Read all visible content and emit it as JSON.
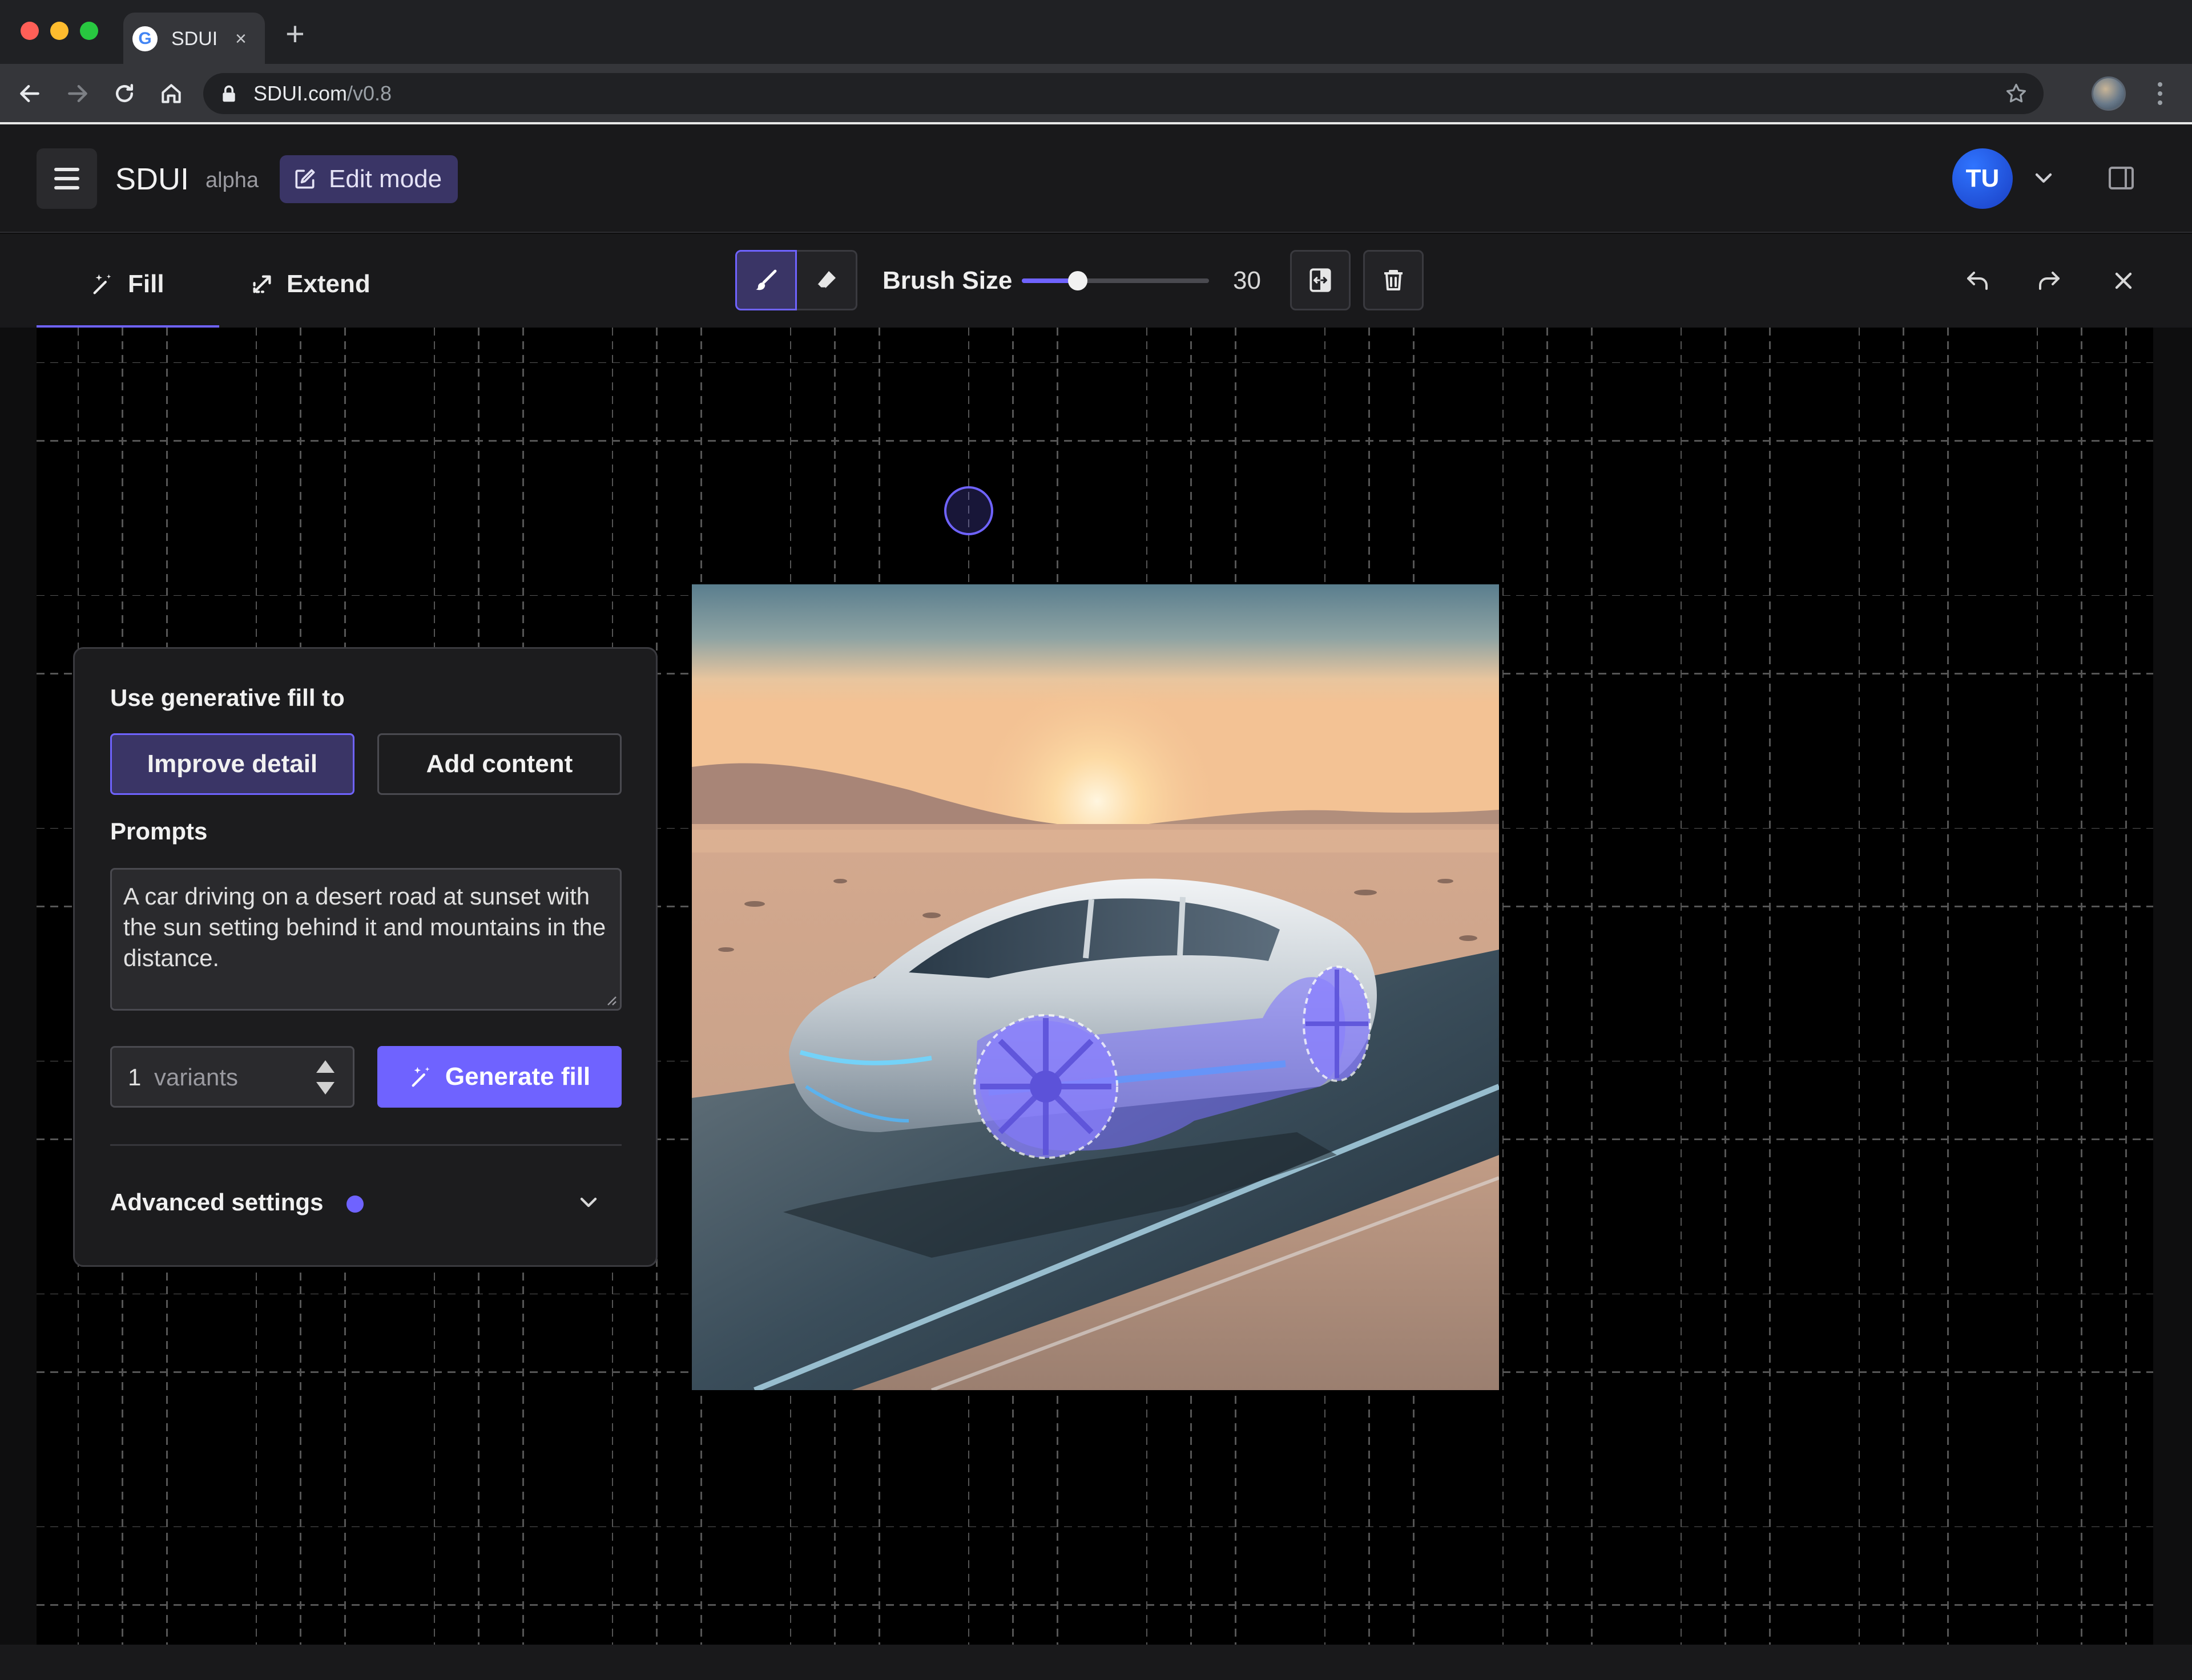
{
  "browser": {
    "tab_title": "SDUI",
    "tab_close": "×",
    "new_tab": "+",
    "favicon_letter": "G",
    "url_host": "SDUI.com",
    "url_path": "/v0.8"
  },
  "header": {
    "brand": "SDUI",
    "brand_tag": "alpha",
    "edit_mode_label": "Edit mode",
    "user_initials": "TU"
  },
  "editor": {
    "tabs": [
      {
        "label": "Fill",
        "active": true
      },
      {
        "label": "Extend",
        "active": false
      }
    ],
    "brush_size_label": "Brush Size",
    "brush_size_value": "30",
    "brush_size_fraction": 0.3
  },
  "panel": {
    "heading": "Use generative fill to",
    "option_improve": "Improve detail",
    "option_add": "Add content",
    "prompts_label": "Prompts",
    "prompt_value": "A car driving on a desert road at sunset with the sun setting behind it and mountains in the distance.",
    "variants_count": "1",
    "variants_unit": "variants",
    "generate_label": "Generate fill",
    "advanced_label": "Advanced settings"
  },
  "colors": {
    "accent": "#6f63ff",
    "accent_dark": "#3a3566",
    "panel_bg": "#1c1c1e",
    "canvas_bg": "#000000"
  }
}
